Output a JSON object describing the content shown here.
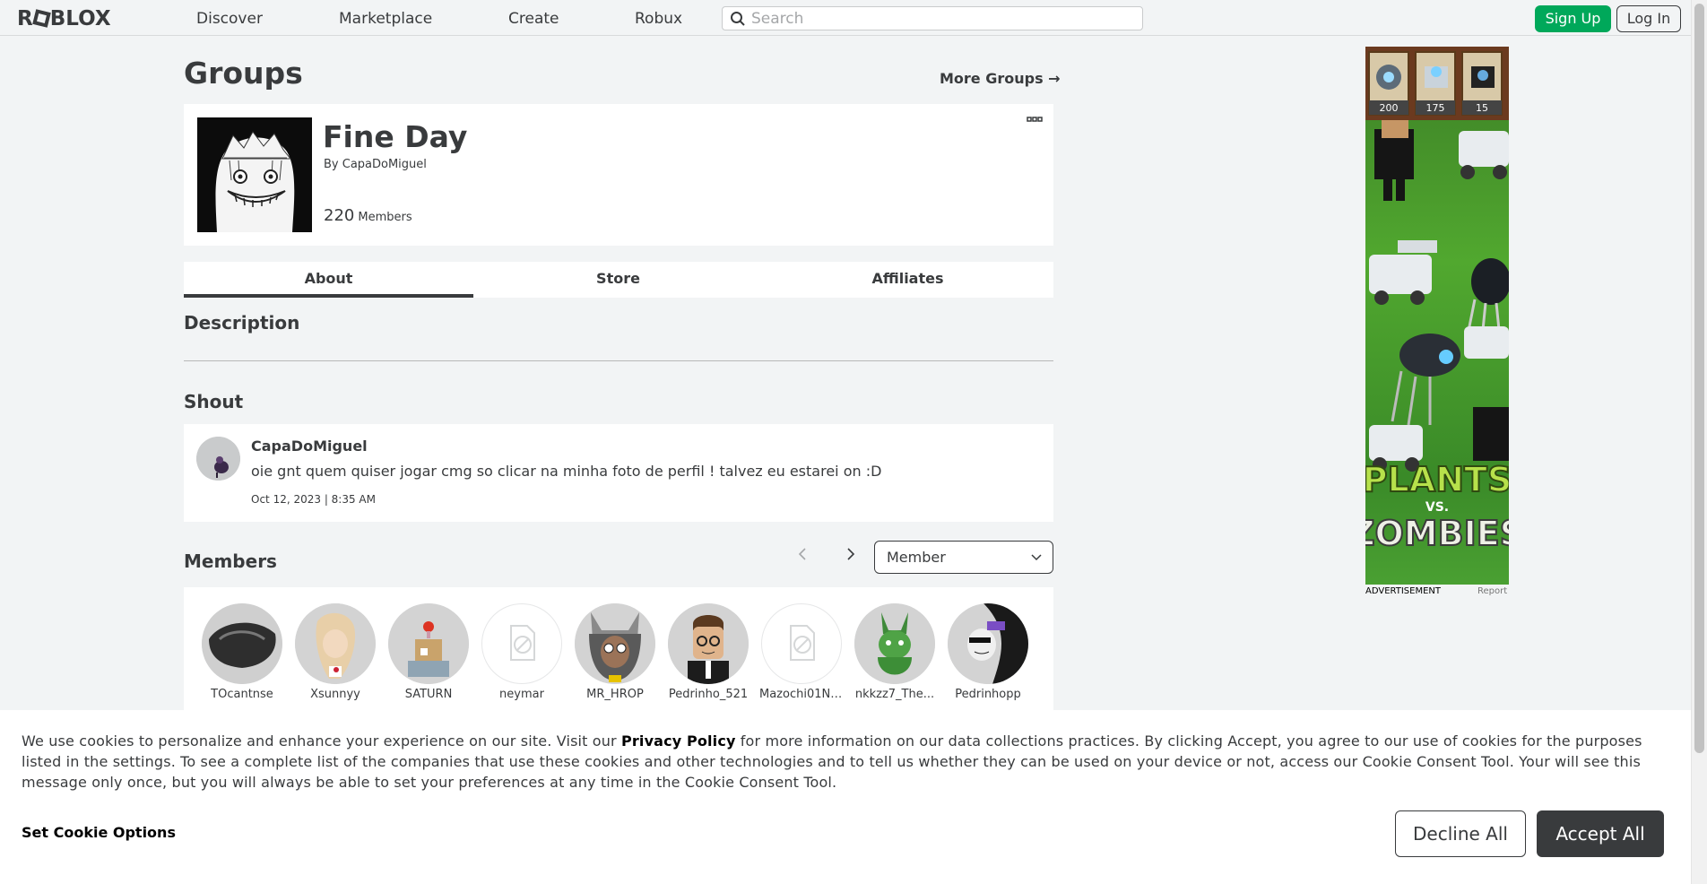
{
  "header": {
    "logo": "ROBLOX",
    "nav": [
      "Discover",
      "Marketplace",
      "Create",
      "Robux"
    ],
    "search_placeholder": "Search",
    "signup_label": "Sign Up",
    "login_label": "Log In"
  },
  "page": {
    "title": "Groups",
    "more_groups_label": "More Groups →"
  },
  "group": {
    "name": "Fine Day",
    "by_label": "By CapaDoMiguel",
    "member_count": "220",
    "members_word": "Members"
  },
  "tabs": [
    "About",
    "Store",
    "Affiliates"
  ],
  "sections": {
    "description": "Description",
    "shout": "Shout",
    "members": "Members"
  },
  "shout": {
    "user": "CapaDoMiguel",
    "body": "oie gnt quem quiser jogar cmg so clicar na minha foto de perfil ! talvez eu estarei on :D",
    "time": "Oct 12, 2023 | 8:35 AM"
  },
  "members_filter": "Member",
  "members": [
    {
      "name": "TOcantnse"
    },
    {
      "name": "Xsunnyy"
    },
    {
      "name": "SATURN"
    },
    {
      "name": "neymar"
    },
    {
      "name": "MR_HROP"
    },
    {
      "name": "Pedrinho_521"
    },
    {
      "name": "Mazochi01Ni..."
    },
    {
      "name": "nkkzz7_The..."
    },
    {
      "name": "Pedrinhopp"
    }
  ],
  "ad": {
    "label": "ADVERTISEMENT",
    "report": "Report",
    "art_title_1": "PLANTS",
    "art_title_2": "VS.",
    "art_title_3": "ZOMBIES",
    "prices": [
      "200",
      "175",
      "15"
    ]
  },
  "cookie": {
    "text_before": "We use cookies to personalize and enhance your experience on our site. Visit our ",
    "privacy_link": "Privacy Policy",
    "text_after": " for more information on our data collections practices. By clicking Accept, you agree to our use of cookies for the purposes listed in the settings. To see a complete list of the companies that use these cookies and other technologies and to tell us whether they can be used on your device or not, access our Cookie Consent Tool. Your will see this message only once, but you will always be able to set your preferences at any time in the Cookie Consent Tool.",
    "options_label": "Set Cookie Options",
    "decline_label": "Decline All",
    "accept_label": "Accept All"
  }
}
